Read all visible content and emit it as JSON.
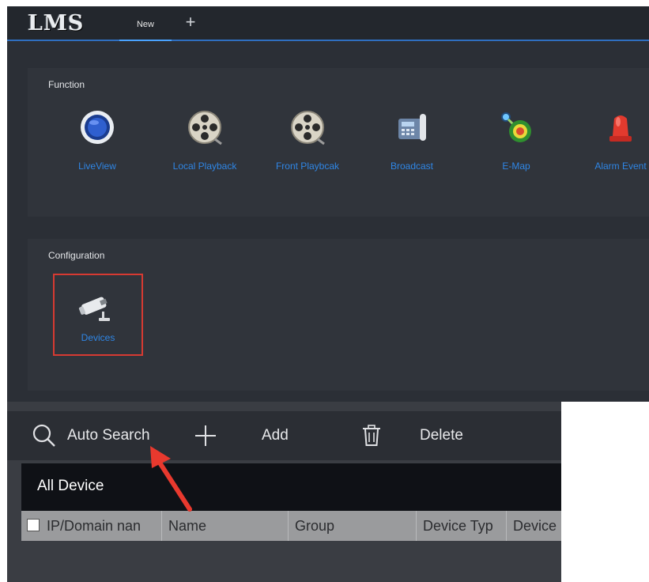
{
  "app": {
    "logo": "LMS",
    "tabs": [
      {
        "label": "New"
      }
    ],
    "add_tab_label": "+"
  },
  "function_panel": {
    "title": "Function",
    "items": [
      {
        "label": "LiveView",
        "icon": "liveview-icon"
      },
      {
        "label": "Local Playback",
        "icon": "film-reel-icon"
      },
      {
        "label": "Front Playbcak",
        "icon": "film-reel-icon"
      },
      {
        "label": "Broadcast",
        "icon": "phone-icon"
      },
      {
        "label": "E-Map",
        "icon": "map-pin-icon"
      },
      {
        "label": "Alarm Event",
        "icon": "alarm-siren-icon"
      }
    ]
  },
  "config_panel": {
    "title": "Configuration",
    "items": [
      {
        "label": "Devices",
        "icon": "camera-icon"
      }
    ]
  },
  "device_window": {
    "toolbar": {
      "auto_search": "Auto Search",
      "add": "Add",
      "delete": "Delete"
    },
    "all_device_title": "All Device",
    "columns": [
      "IP/Domain nan",
      "Name",
      "Group",
      "Device Typ",
      "Device"
    ]
  },
  "colors": {
    "accent": "#2f86e5",
    "highlight_border": "#d63a32",
    "arrow": "#e8392e"
  }
}
